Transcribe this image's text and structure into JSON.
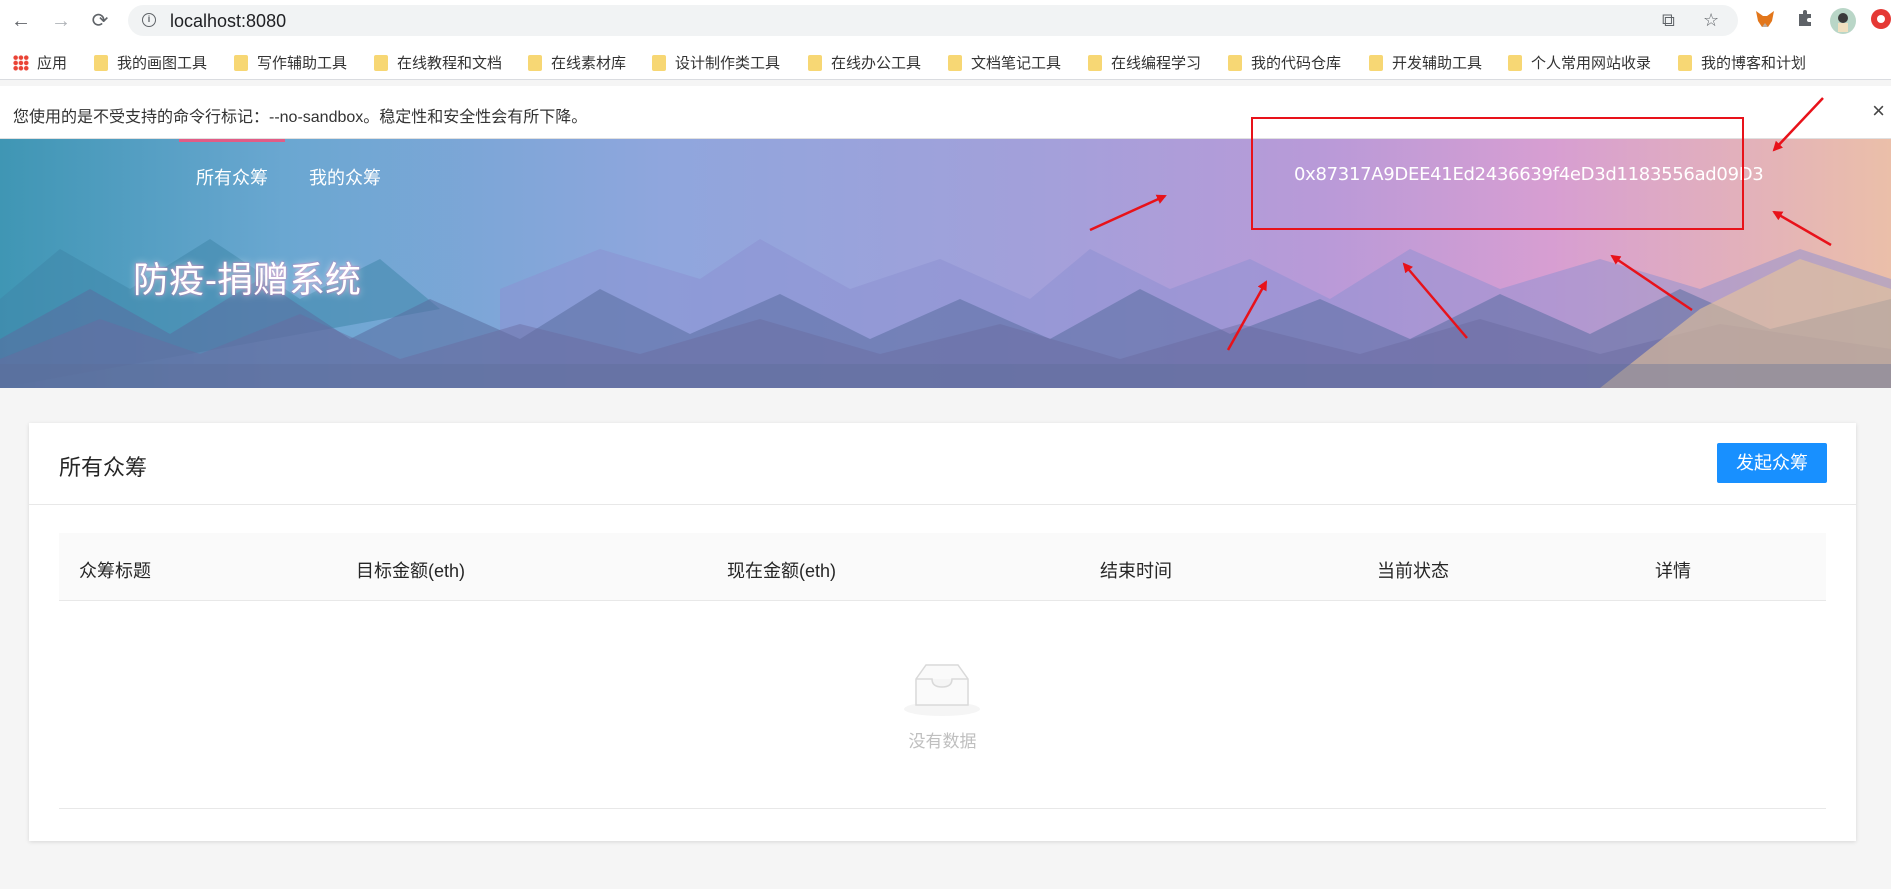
{
  "browser": {
    "url": "localhost:8080",
    "icons": [
      "back-arrow-icon",
      "forward-arrow-icon",
      "reload-icon",
      "info-icon",
      "translate-icon",
      "star-icon",
      "metamask-fox-icon",
      "puzzle-extension-icon",
      "profile-avatar-icon",
      "red-extension-icon"
    ]
  },
  "bookmarks": [
    "应用",
    "我的画图工具",
    "写作辅助工具",
    "在线教程和文档",
    "在线素材库",
    "设计制作类工具",
    "在线办公工具",
    "文档笔记工具",
    "在线编程学习",
    "我的代码仓库",
    "开发辅助工具",
    "个人常用网站收录",
    "我的博客和计划"
  ],
  "warning": {
    "message": "您使用的是不受支持的命令行标记：--no-sandbox。稳定性和安全性会有所下降。",
    "close": "×"
  },
  "header": {
    "nav": [
      "所有众筹",
      "我的众筹"
    ],
    "account": "0x87317A9DEE41Ed2436639f4eD3d1183556ad09D3",
    "title": "防疫-捐赠系统"
  },
  "card": {
    "title": "所有众筹",
    "create_button": "发起众筹",
    "columns": [
      "众筹标题",
      "目标金额(eth)",
      "现在金额(eth)",
      "结束时间",
      "当前状态",
      "详情"
    ],
    "empty_text": "没有数据"
  },
  "colors": {
    "primary": "#1890ff",
    "annotation_red": "#e8121a",
    "active_tab": "#e25c86"
  }
}
